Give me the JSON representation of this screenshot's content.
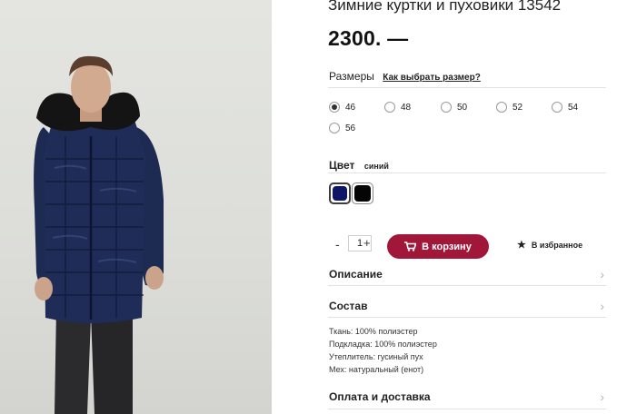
{
  "product": {
    "title": "Зимние куртки и пуховики 13542",
    "price": "2300. —"
  },
  "sizes": {
    "label": "Размеры",
    "help_link": "Как выбрать размер?",
    "options": [
      "46",
      "48",
      "50",
      "52",
      "54",
      "56"
    ],
    "selected": "46"
  },
  "color": {
    "label": "Цвет",
    "selected_name": "синий",
    "swatches": [
      "#0d1766",
      "#050505"
    ]
  },
  "quantity": {
    "minus": "-",
    "value": "1",
    "plus": "+"
  },
  "actions": {
    "cart_label": "В корзину",
    "favorites_label": "В избранное",
    "cart_color": "#a1173a"
  },
  "sections": {
    "description": "Описание",
    "composition": "Состав",
    "delivery": "Оплата и доставка"
  },
  "specs": [
    "Ткань: 100% полиэстер",
    "Подкладка: 100% полиэстер",
    "Утеплитель: гусиный пух",
    "Мех: натуральный (енот)"
  ]
}
